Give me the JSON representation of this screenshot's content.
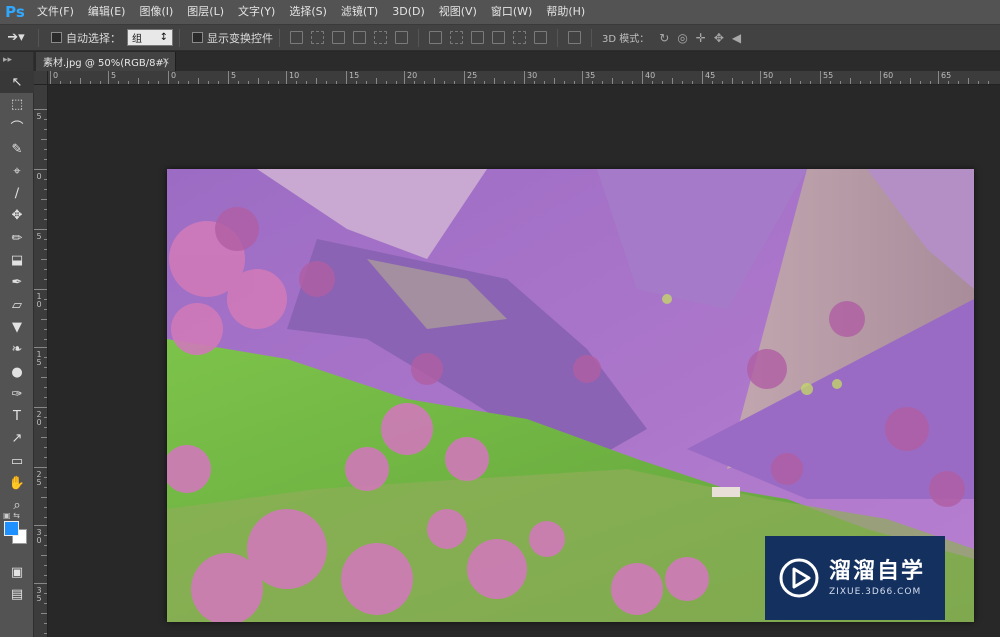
{
  "app": {
    "logo": "Ps"
  },
  "menu": [
    "文件(F)",
    "编辑(E)",
    "图像(I)",
    "图层(L)",
    "文字(Y)",
    "选择(S)",
    "滤镜(T)",
    "3D(D)",
    "视图(V)",
    "窗口(W)",
    "帮助(H)"
  ],
  "options": {
    "tool_icon": "move-tool-icon",
    "auto_select_label": "自动选择：",
    "auto_select_value": "组",
    "show_transform_label": "显示变换控件",
    "mode_3d_label": "3D 模式："
  },
  "tab": {
    "title": "素材.jpg @ 50%(RGB/8#)",
    "close": "×"
  },
  "ruler": {
    "h_labels": [
      "0",
      "5",
      "0",
      "5",
      "10",
      "15",
      "20",
      "25",
      "30",
      "35",
      "40",
      "45",
      "50",
      "55",
      "60",
      "65"
    ],
    "v_labels": [
      "5",
      "0",
      "5",
      "1 0",
      "1 5",
      "2 0",
      "2 5",
      "3 0",
      "3 5"
    ]
  },
  "tools": [
    "move-tool-icon",
    "marquee-icon",
    "lasso-icon",
    "quick-select-icon",
    "crop-icon",
    "eyedropper-icon",
    "healing-icon",
    "brush-icon",
    "stamp-icon",
    "history-brush-icon",
    "eraser-icon",
    "paint-bucket-icon",
    "blur-icon",
    "dodge-icon",
    "pen-icon",
    "type-icon",
    "path-select-icon",
    "shape-icon",
    "hand-icon",
    "zoom-icon"
  ],
  "colors": {
    "foreground": "#1e90ff",
    "background": "#ffffff"
  },
  "watermark": {
    "title": "溜溜自学",
    "subtitle": "ZIXUE.3D66.COM"
  }
}
